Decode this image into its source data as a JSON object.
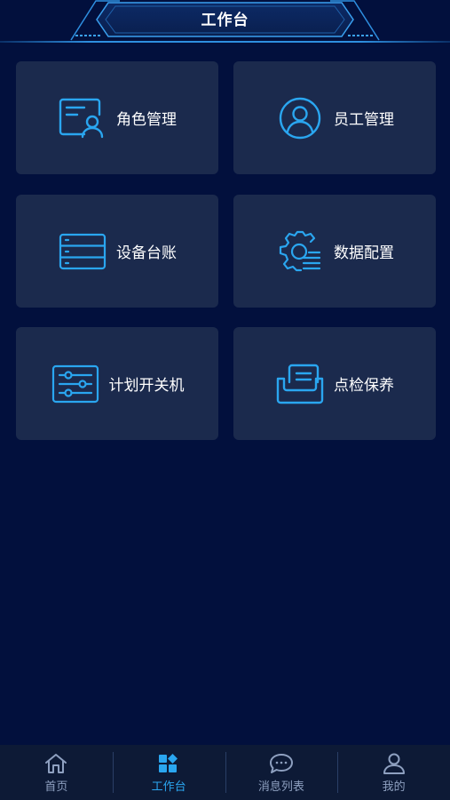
{
  "header": {
    "title": "工作台"
  },
  "grid": {
    "items": [
      {
        "label": "角色管理",
        "icon": "role-card-icon"
      },
      {
        "label": "员工管理",
        "icon": "user-circle-icon"
      },
      {
        "label": "设备台账",
        "icon": "server-list-icon"
      },
      {
        "label": "数据配置",
        "icon": "gear-list-icon"
      },
      {
        "label": "计划开关机",
        "icon": "sliders-icon"
      },
      {
        "label": "点检保养",
        "icon": "inbox-doc-icon"
      }
    ]
  },
  "tabbar": {
    "items": [
      {
        "label": "首页",
        "icon": "home-icon",
        "active": false
      },
      {
        "label": "工作台",
        "icon": "grid-icon",
        "active": true
      },
      {
        "label": "消息列表",
        "icon": "chat-icon",
        "active": false
      },
      {
        "label": "我的",
        "icon": "person-icon",
        "active": false
      }
    ]
  },
  "colors": {
    "background": "#02103d",
    "card": "#1b2a4d",
    "accent": "#2aa6f0",
    "tabbar": "#0d1a36"
  }
}
